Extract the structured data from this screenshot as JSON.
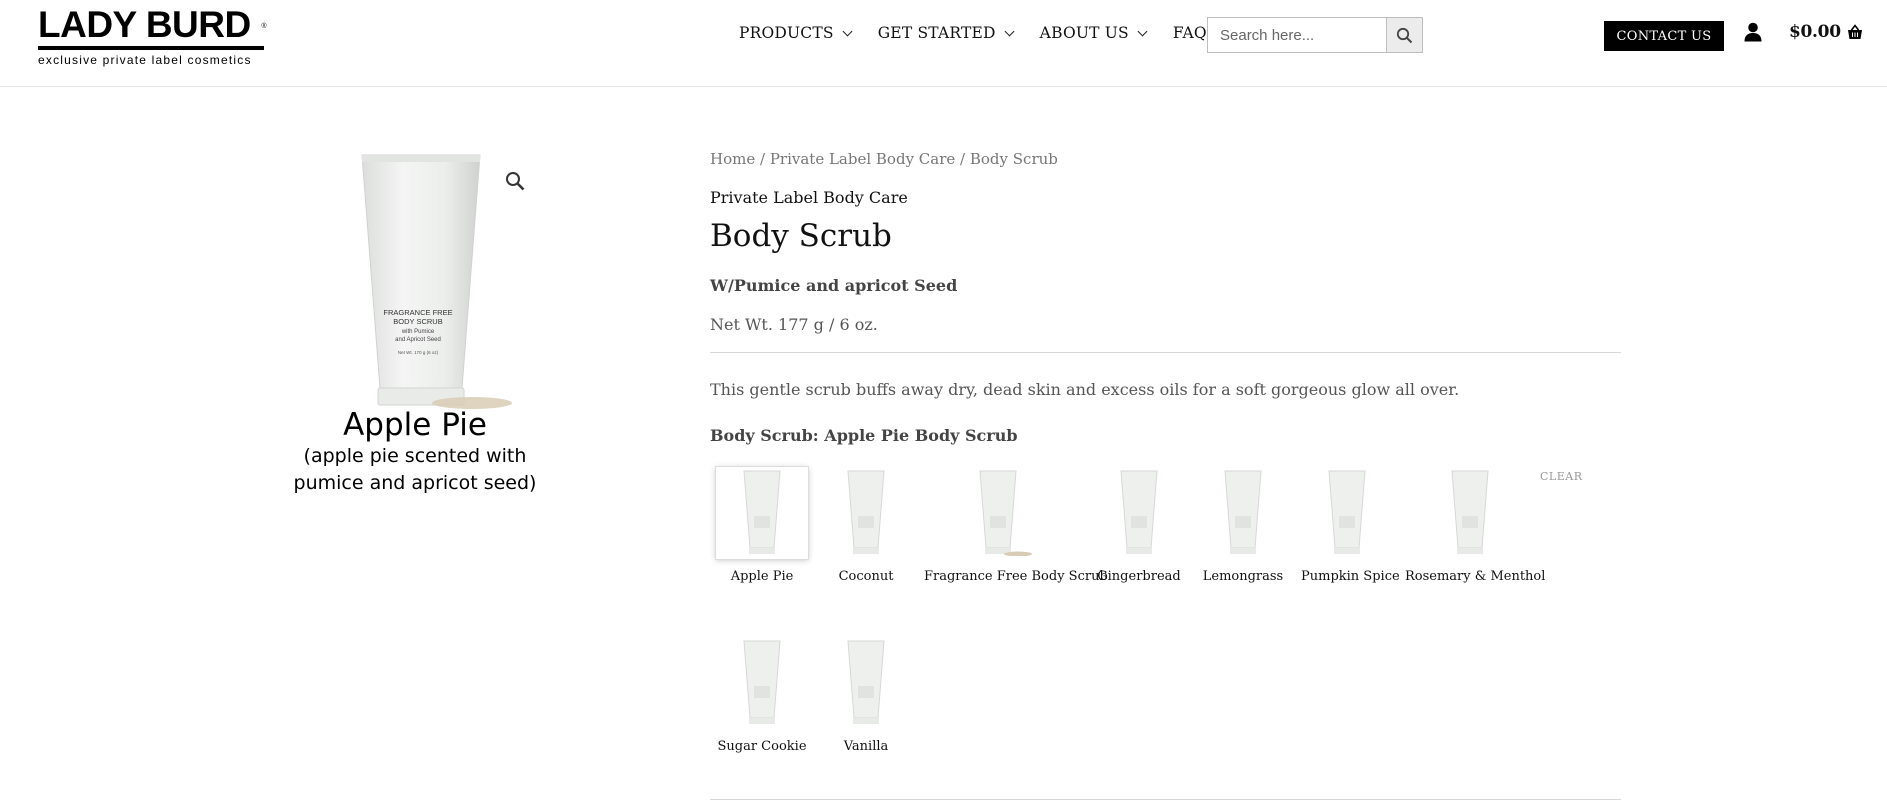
{
  "brand": {
    "name": "LADY BURD",
    "registered": "®",
    "tagline": "exclusive private label cosmetics"
  },
  "nav": {
    "items": [
      {
        "label": "PRODUCTS",
        "has_dropdown": true
      },
      {
        "label": "GET STARTED",
        "has_dropdown": true
      },
      {
        "label": "ABOUT US",
        "has_dropdown": true
      },
      {
        "label": "FAQS",
        "has_dropdown": false
      }
    ]
  },
  "search": {
    "placeholder": "Search here...",
    "icon": "search-icon"
  },
  "header_actions": {
    "contact_label": "CONTACT US",
    "account_icon": "user-icon",
    "cart_total": "$0.00",
    "cart_icon": "basket-icon"
  },
  "product_image": {
    "tube_label_lines": [
      "FRAGRANCE FREE",
      "BODY SCRUB",
      "with Pumice",
      "and Apricot Seed",
      "Net Wt. 170 g (6 oz)"
    ],
    "caption_title": "Apple Pie",
    "caption_subtitle_line1": "(apple pie scented with",
    "caption_subtitle_line2": "pumice and apricot seed)",
    "zoom_icon": "magnifier-icon"
  },
  "breadcrumb": {
    "items": [
      "Home",
      "Private Label Body Care",
      "Body Scrub"
    ],
    "separator": " / "
  },
  "product": {
    "category": "Private Label Body Care",
    "title": "Body Scrub",
    "subtitle": "W/Pumice and apricot Seed",
    "net_weight": "Net Wt. 177 g / 6 oz.",
    "description": "This gentle scrub buffs away dry, dead skin and excess oils for a soft gorgeous glow all over.",
    "variant_label": "Body Scrub: Apple Pie Body Scrub",
    "clear_label": "CLEAR"
  },
  "variants": [
    {
      "label": "Apple Pie",
      "selected": true
    },
    {
      "label": "Coconut",
      "selected": false
    },
    {
      "label": "Fragrance Free Body Scrub",
      "selected": false
    },
    {
      "label": "Gingerbread",
      "selected": false
    },
    {
      "label": "Lemongrass",
      "selected": false
    },
    {
      "label": "Pumpkin Spice",
      "selected": false
    },
    {
      "label": "Rosemary & Menthol",
      "selected": false
    },
    {
      "label": "Sugar Cookie",
      "selected": false
    },
    {
      "label": "Vanilla",
      "selected": false
    }
  ],
  "colors": {
    "accent": "#000000",
    "text_muted": "#777777",
    "tube": "#eef0ee"
  }
}
